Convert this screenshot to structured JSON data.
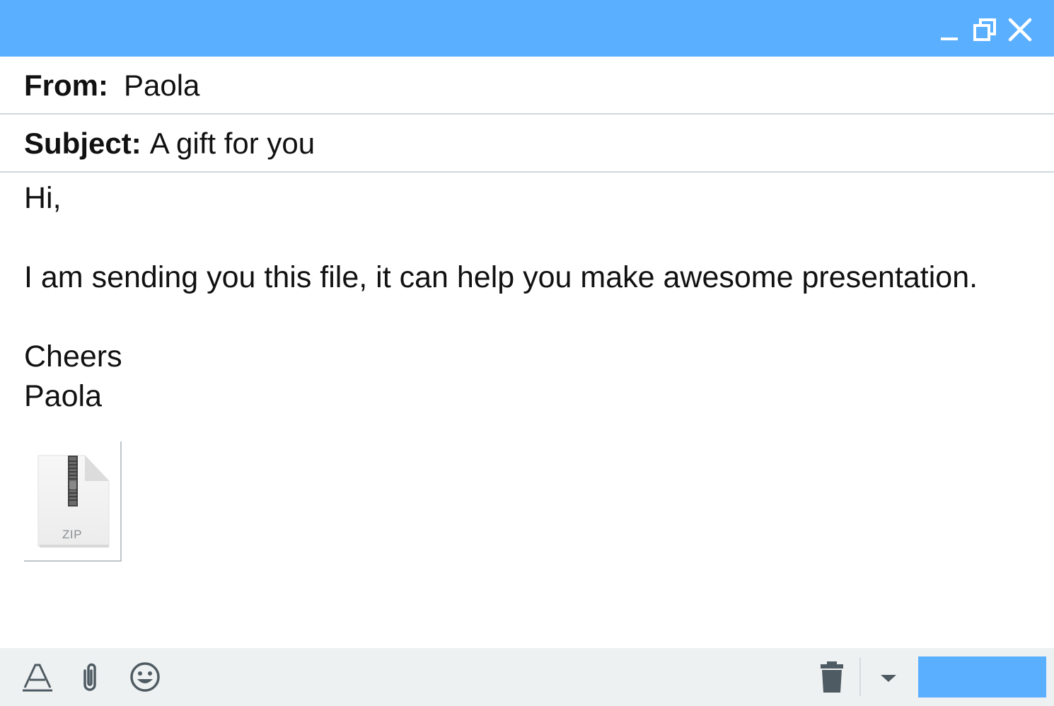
{
  "window": {
    "controls": {
      "minimize_icon": "minimize-icon",
      "restore_icon": "restore-icon",
      "close_icon": "close-icon"
    },
    "accent_color": "#5aafff"
  },
  "email": {
    "from": {
      "label": "From:",
      "value": "Paola"
    },
    "subject": {
      "label": "Subject:",
      "value": "A gift for you"
    },
    "body": {
      "greeting": "Hi,",
      "message": "I am sending you this file, it can help you make awesome presentation.",
      "closing": "Cheers",
      "signature": "Paola"
    },
    "attachment": {
      "type_label": "ZIP",
      "icon": "zip-file-icon"
    }
  },
  "toolbar": {
    "format_icon": "text-format-icon",
    "attach_icon": "paperclip-icon",
    "emoji_icon": "smiley-icon",
    "trash_icon": "trash-icon",
    "dropdown_icon": "caret-down-icon",
    "send_label": ""
  }
}
